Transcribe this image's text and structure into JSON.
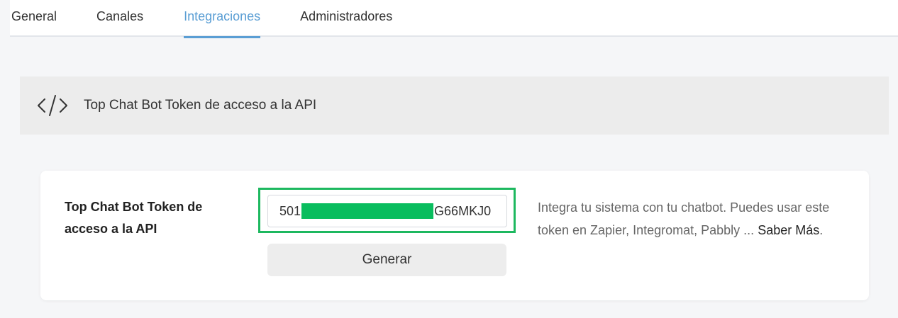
{
  "tabs": {
    "general": "General",
    "canales": "Canales",
    "integraciones": "Integraciones",
    "administradores": "Administradores",
    "active": "Integraciones"
  },
  "section": {
    "title": "Top Chat Bot Token de acceso a la API",
    "icon": "code-icon"
  },
  "token_card": {
    "label": "Top Chat Bot Token de acceso a la API",
    "token_prefix": "501",
    "token_suffix": "G66MKJ0",
    "generate_label": "Generar",
    "help_text": "Integra tu sistema con tu chatbot. Puedes usar este token en Zapier, Integromat, Pabbly ... ",
    "help_link": "Saber Más",
    "help_end": "."
  },
  "colors": {
    "accent": "#5a9ed4",
    "highlight": "#1db85f",
    "mask": "#09bd5e"
  }
}
